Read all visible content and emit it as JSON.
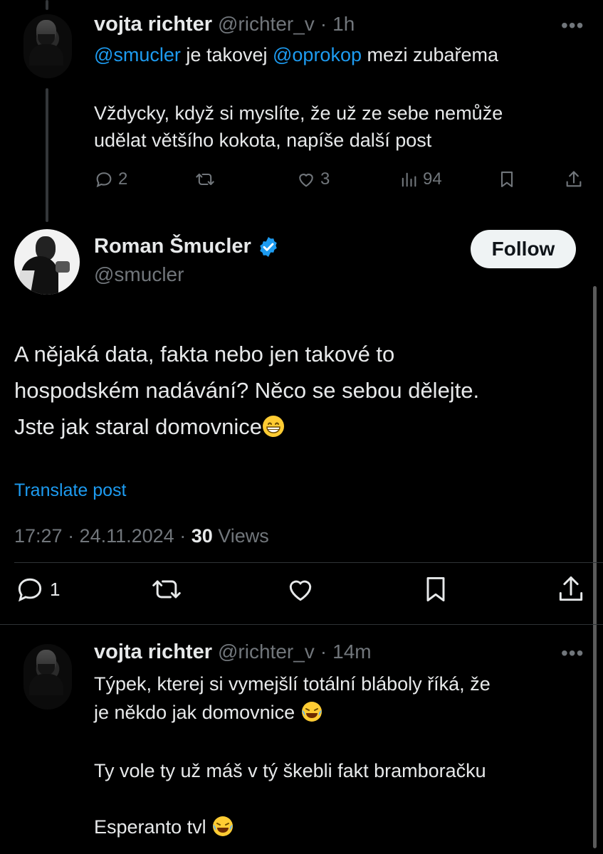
{
  "tweet1": {
    "name": "vojta richter",
    "handle": "@richter_v",
    "sep": "·",
    "time": "1h",
    "more": "•••",
    "mention1": "@smucler",
    "text_mid": " je takovej ",
    "mention2": "@oprokop",
    "text_end": " mezi zubařema",
    "para2": "Vždycky, když si myslíte, že už ze sebe nemůže\nudělat většího kokota, napíše další post",
    "replies": "2",
    "likes": "3",
    "views": "94"
  },
  "main": {
    "name": "Roman Šmucler",
    "handle": "@smucler",
    "follow_label": "Follow",
    "text": "A nějaká data, fakta nebo jen takové to\nhospodském nadávání? Něco se sebou dělejte.\nJste jak staral domovnice",
    "translate": "Translate post",
    "timestamp": "17:27 · 24.11.2024 · ",
    "views_count": "30",
    "views_label": " Views",
    "reply_count": "1"
  },
  "tweet3": {
    "name": "vojta richter",
    "handle": "@richter_v",
    "sep": "·",
    "time": "14m",
    "more": "•••",
    "line1": "Týpek, kterej si vymejšlí totální bláboly říká, že",
    "line2": "je někdo jak domovnice ",
    "line3": "Ty vole ty už máš v tý škebli fakt bramboračku",
    "line4": "Esperanto tvl "
  },
  "colors": {
    "background": "#000000",
    "text": "#e7e9ea",
    "muted": "#71767b",
    "link": "#1d9bf0",
    "divider": "#2f3336"
  }
}
